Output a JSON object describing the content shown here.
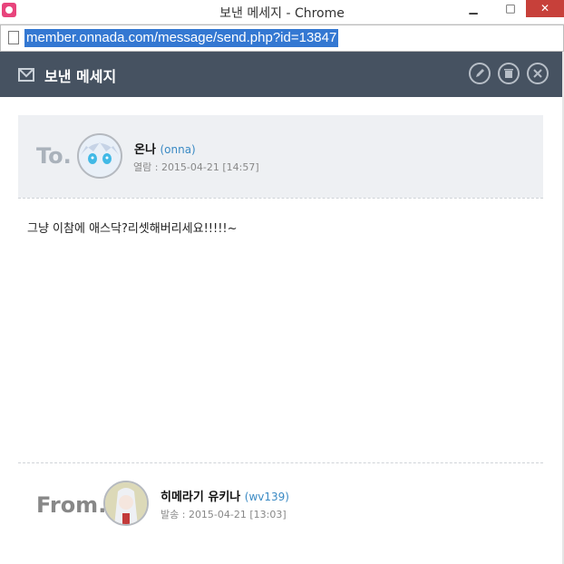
{
  "window": {
    "title": "보낸 메세지 - Chrome",
    "min_symbol": "▁",
    "max_symbol": "□",
    "close_symbol": "✕"
  },
  "address_bar": {
    "url": "member.onnada.com/message/send.php?id=13847"
  },
  "header": {
    "title": "보낸 메세지",
    "icon": "envelope-icon",
    "actions": [
      "edit-icon",
      "trash-icon",
      "close-icon"
    ]
  },
  "recipient": {
    "label": "To.",
    "name": "온나",
    "id": "(onna)",
    "meta": "열람 : 2015-04-21 [14:57]"
  },
  "message": {
    "text": "그냥 이참에 애스닥?리셋해버리세요!!!!!~"
  },
  "sender": {
    "label": "From.",
    "name": "히메라기 유키나",
    "id": "(wv139)",
    "meta": "발송 : 2015-04-21 [13:03]"
  },
  "colors": {
    "header_bg": "#465261",
    "to_bg": "#eef0f3",
    "id_link": "#3a8ac4",
    "selection": "#3478d2"
  }
}
